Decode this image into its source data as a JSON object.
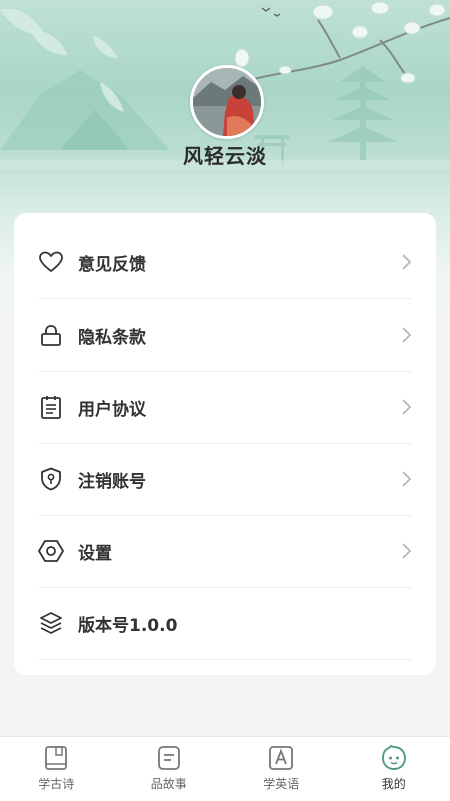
{
  "profile": {
    "username": "风轻云淡"
  },
  "menu": {
    "items": [
      {
        "label": "意见反馈",
        "icon": "heart-icon"
      },
      {
        "label": "隐私条款",
        "icon": "lock-icon"
      },
      {
        "label": "用户协议",
        "icon": "document-icon"
      },
      {
        "label": "注销账号",
        "icon": "shield-key-icon"
      },
      {
        "label": "设置",
        "icon": "hexagon-settings-icon"
      },
      {
        "label": "版本号1.0.0",
        "icon": "layers-icon"
      }
    ]
  },
  "tabbar": {
    "tabs": [
      {
        "label": "学古诗",
        "icon": "book-icon"
      },
      {
        "label": "品故事",
        "icon": "story-icon"
      },
      {
        "label": "学英语",
        "icon": "letter-a-icon"
      },
      {
        "label": "我的",
        "icon": "face-icon",
        "active": true
      }
    ]
  },
  "colors": {
    "header_top": "#a9d6c8",
    "accent": "#6fb3a3",
    "active_tab": "#4f9a88"
  }
}
